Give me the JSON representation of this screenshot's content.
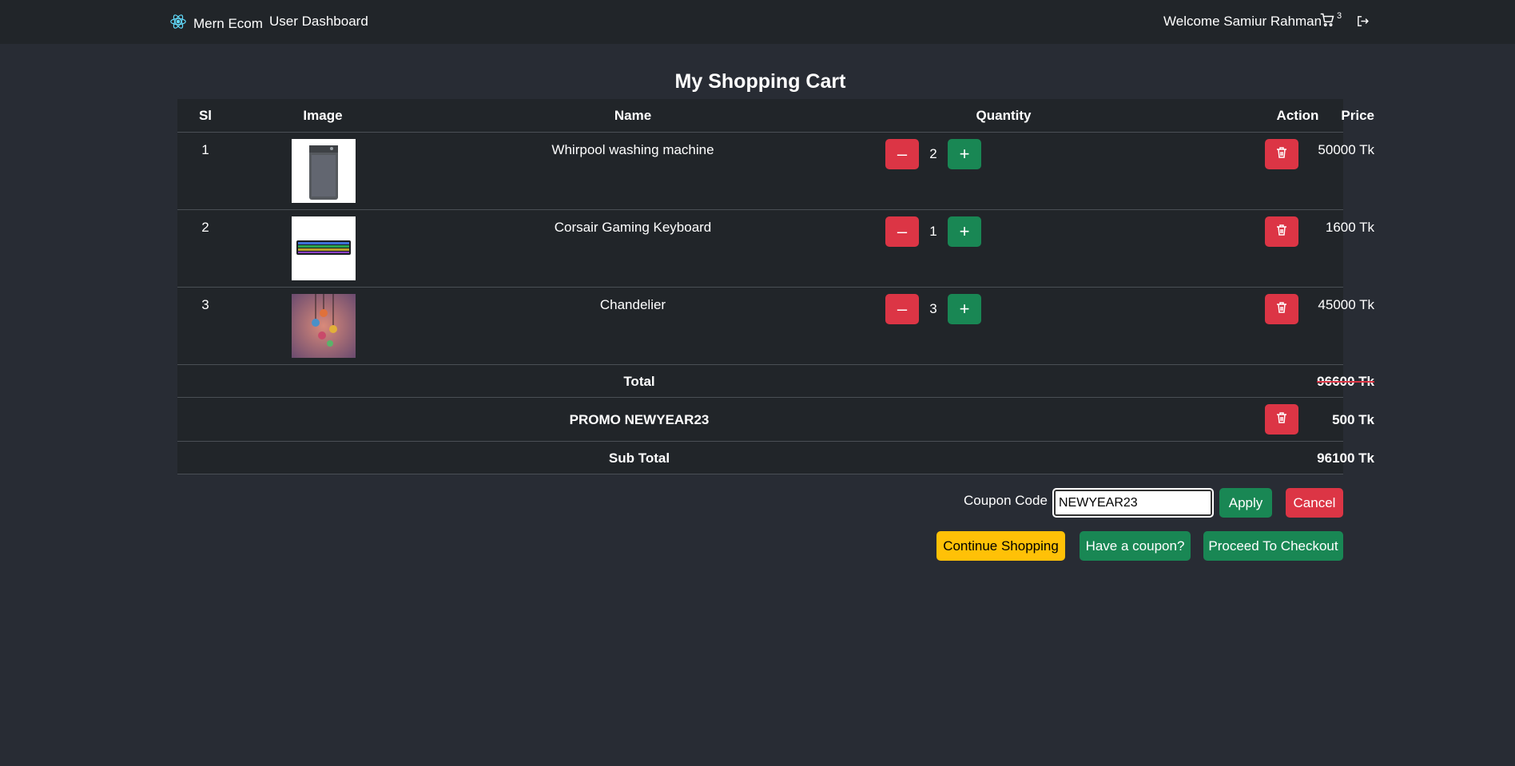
{
  "nav": {
    "brand": "Mern Ecom",
    "dashboard": "User Dashboard",
    "welcome": "Welcome Samiur Rahman",
    "cart_count": "3",
    "icons": {
      "brand": "react-icon",
      "cart": "cart-icon",
      "logout": "logout-icon"
    }
  },
  "page_title": "My Shopping Cart",
  "table": {
    "headers": [
      "Sl",
      "Image",
      "Name",
      "Quantity",
      "Price",
      "Action"
    ],
    "rows": [
      {
        "sl": "1",
        "name": "Whirpool washing machine",
        "qty": "2",
        "price": "50000 Tk"
      },
      {
        "sl": "2",
        "name": "Corsair Gaming Keyboard",
        "qty": "1",
        "price": "1600 Tk"
      },
      {
        "sl": "3",
        "name": "Chandelier",
        "qty": "3",
        "price": "45000 Tk"
      }
    ],
    "decrement": "–",
    "increment": "+"
  },
  "summary": {
    "total_label": "Total",
    "total_value": "96600 Tk",
    "promo_label": "PROMO NEWYEAR23",
    "promo_value": "500 Tk",
    "subtotal_label": "Sub Total",
    "subtotal_value": "96100 Tk"
  },
  "coupon": {
    "label": "Coupon Code",
    "value": "NEWYEAR23",
    "apply": "Apply",
    "cancel": "Cancel"
  },
  "actions": {
    "continue": "Continue Shopping",
    "have_coupon": "Have a coupon?",
    "checkout": "Proceed To Checkout"
  },
  "colors": {
    "background": "#282c34",
    "navbar": "#212529",
    "danger": "#dc3545",
    "success": "#198754",
    "warning": "#ffc107"
  }
}
